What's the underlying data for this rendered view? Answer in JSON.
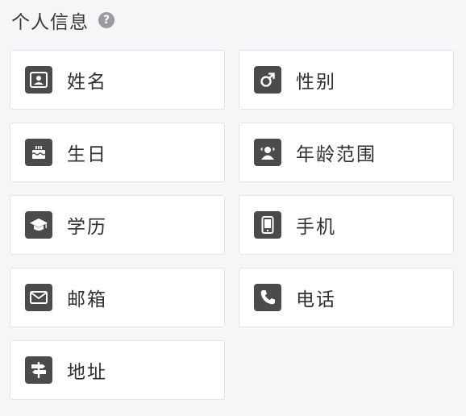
{
  "header": {
    "title": "个人信息",
    "help_icon": "?"
  },
  "fields": [
    {
      "label": "姓名",
      "icon": "contact-card-icon"
    },
    {
      "label": "性别",
      "icon": "male-symbol-icon"
    },
    {
      "label": "生日",
      "icon": "birthday-cake-icon"
    },
    {
      "label": "年龄范围",
      "icon": "age-range-icon"
    },
    {
      "label": "学历",
      "icon": "graduation-cap-icon"
    },
    {
      "label": "手机",
      "icon": "mobile-phone-icon"
    },
    {
      "label": "邮箱",
      "icon": "envelope-icon"
    },
    {
      "label": "电话",
      "icon": "telephone-icon"
    },
    {
      "label": "地址",
      "icon": "signpost-icon"
    }
  ],
  "colors": {
    "icon_background": "#4b4b4e",
    "card_background": "#ffffff",
    "page_background": "#f6f6f8"
  }
}
